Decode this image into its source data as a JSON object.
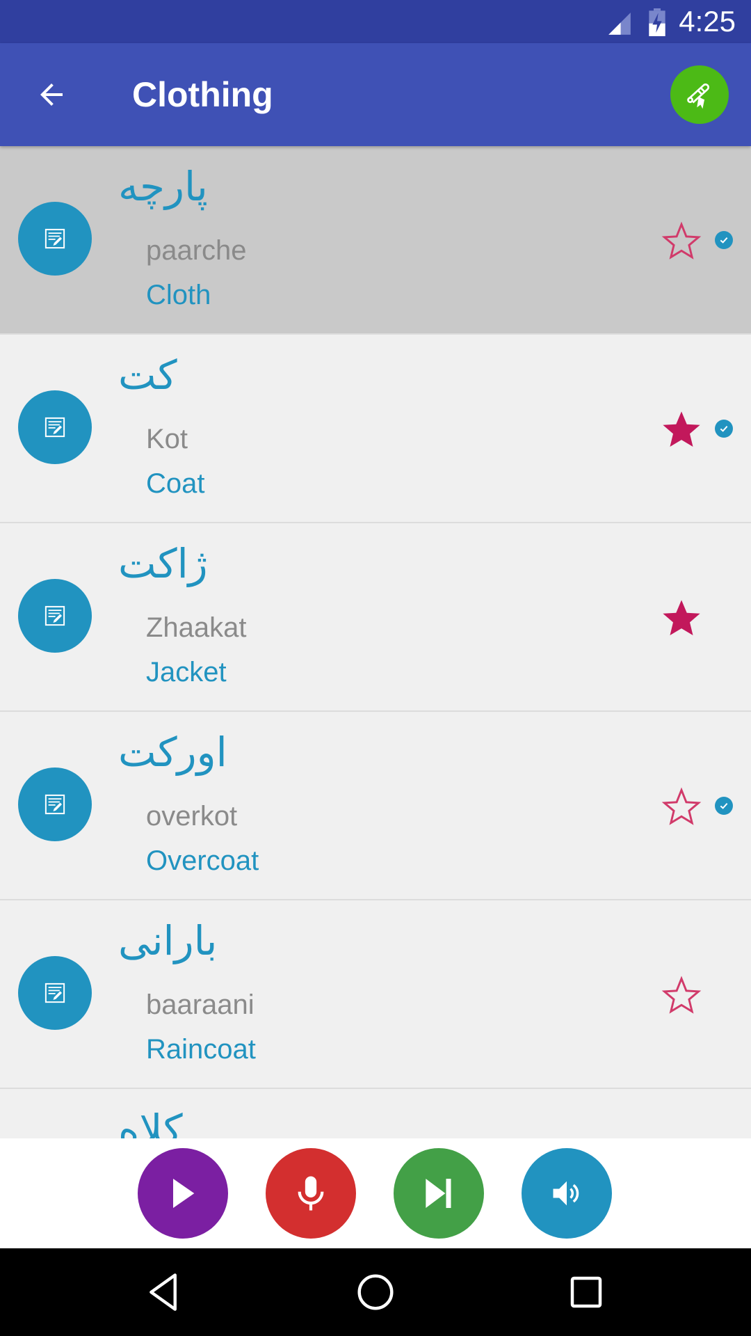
{
  "status_bar": {
    "time": "4:25",
    "icons": [
      "cell-signal-icon",
      "battery-charging-icon"
    ]
  },
  "app_bar": {
    "title": "Clothing",
    "back_icon": "arrow-left-icon",
    "action_icon": "diploma-scroll-icon",
    "action_color": "#4cba16"
  },
  "colors": {
    "primary": "#3f51b5",
    "primary_dark": "#303f9f",
    "accent_blue": "#2193c0",
    "star_red": "#c2185b",
    "selected_row": "#c9c9c9",
    "row_bg": "#f0f0f0"
  },
  "words": [
    {
      "native": "پارچه",
      "transliteration": "paarche",
      "english": "Cloth",
      "favorite": false,
      "learned": true,
      "selected": true
    },
    {
      "native": "کت",
      "transliteration": "Kot",
      "english": "Coat",
      "favorite": true,
      "learned": true,
      "selected": false
    },
    {
      "native": "ژاکت",
      "transliteration": "Zhaakat",
      "english": "Jacket",
      "favorite": true,
      "learned": false,
      "selected": false
    },
    {
      "native": "اورکت",
      "transliteration": "overkot",
      "english": "Overcoat",
      "favorite": false,
      "learned": true,
      "selected": false
    },
    {
      "native": "بارانی",
      "transliteration": "baaraani",
      "english": "Raincoat",
      "favorite": false,
      "learned": false,
      "selected": false
    },
    {
      "native": "کلاه",
      "transliteration": "",
      "english": "",
      "favorite": false,
      "learned": false,
      "selected": false
    }
  ],
  "controls": [
    {
      "name": "play",
      "icon": "play-icon",
      "color": "#7b1fa2"
    },
    {
      "name": "record",
      "icon": "microphone-icon",
      "color": "#d32f2f"
    },
    {
      "name": "next",
      "icon": "skip-next-icon",
      "color": "#43a047"
    },
    {
      "name": "speaker",
      "icon": "volume-icon",
      "color": "#2193c0"
    }
  ],
  "nav_bar": {
    "buttons": [
      "back-triangle-icon",
      "home-circle-icon",
      "recents-square-icon"
    ]
  }
}
